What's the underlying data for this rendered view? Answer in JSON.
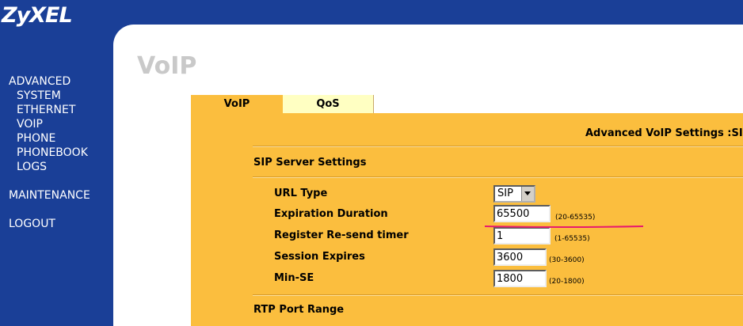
{
  "brand": {
    "logo_text": "ZyXEL"
  },
  "sidebar": {
    "items": [
      {
        "label": "ADVANCED"
      },
      {
        "label": "SYSTEM"
      },
      {
        "label": "ETHERNET"
      },
      {
        "label": "VOIP"
      },
      {
        "label": "PHONE"
      },
      {
        "label": "PHONEBOOK"
      },
      {
        "label": "LOGS"
      },
      {
        "label": "MAINTENANCE"
      },
      {
        "label": "LOGOUT"
      }
    ]
  },
  "page": {
    "title": "VoIP"
  },
  "tabs": [
    {
      "label": "VoIP",
      "active": true
    },
    {
      "label": "QoS",
      "active": false
    }
  ],
  "heading": "Advanced VoIP Settings :SIP",
  "sections": {
    "sip_server": {
      "title": "SIP Server Settings",
      "url_type": {
        "label": "URL Type",
        "value": "SIP"
      },
      "expiration": {
        "label": "Expiration Duration",
        "value": "65500",
        "range": "(20-65535)"
      },
      "register_resend": {
        "label": "Register Re-send timer",
        "value": "1",
        "range": "(1-65535)"
      },
      "session_expires": {
        "label": "Session Expires",
        "value": "3600",
        "range": "(30-3600)"
      },
      "min_se": {
        "label": "Min-SE",
        "value": "1800",
        "range": "(20-1800)"
      }
    },
    "rtp": {
      "title": "RTP Port Range"
    }
  },
  "colors": {
    "sidebar_blue": "#1a3f97",
    "content_orange": "#fbbe3e",
    "tab_inactive": "#ffffc2",
    "annotation_line": "#e8196e"
  }
}
